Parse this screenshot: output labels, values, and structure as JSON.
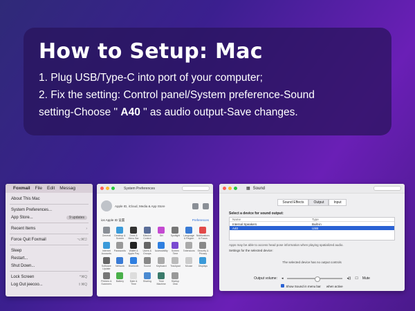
{
  "panel": {
    "title": "How to Setup: Mac",
    "line1": "1. Plug USB/Type-C into port of your computer;",
    "line2": "2. Fix the setting: Control panel/System preference-Sound",
    "line3_pre": "setting-Choose \" ",
    "line3_bold": "A40",
    "line3_post": " \" as audio output-Save changes."
  },
  "apple_menu": {
    "menubar": {
      "apple": "",
      "app": "Foxmail",
      "file": "File",
      "edit": "Edit",
      "message": "Messag"
    },
    "items": [
      {
        "label": "About This Mac"
      },
      {
        "label": "System Preferences..."
      },
      {
        "label": "App Store...",
        "badge": "9 updates"
      },
      {
        "label": "Recent Items",
        "shortcut": "›"
      },
      {
        "label": "Force Quit Foxmail",
        "shortcut": "⌥⌘⎋"
      },
      {
        "label": "Sleep"
      },
      {
        "label": "Restart..."
      },
      {
        "label": "Shut Down..."
      },
      {
        "label": "Lock Screen",
        "shortcut": "^⌘Q"
      },
      {
        "label": "Log Out jeecoo...",
        "shortcut": "⇧⌘Q"
      }
    ]
  },
  "sys_prefs": {
    "title": "System Preferences",
    "user_line": "Apple ID, iCloud, Media & App Store",
    "sub_left": "ios Apple ID 设置",
    "sub_right": "Preferences",
    "icons": [
      {
        "label": "General",
        "color": "#8a8f96"
      },
      {
        "label": "Desktop & Screen Saver",
        "color": "#3a9ad9"
      },
      {
        "label": "Dock & Menu Bar",
        "color": "#333"
      },
      {
        "label": "Mission Control",
        "color": "#5b6e99"
      },
      {
        "label": "Siri",
        "color": "#c44ad1"
      },
      {
        "label": "Spotlight",
        "color": "#777"
      },
      {
        "label": "Language & Region",
        "color": "#3a7bd5"
      },
      {
        "label": "Notifications & Focus",
        "color": "#e24a4a"
      },
      {
        "label": "Internet Accounts",
        "color": "#3a9ad9"
      },
      {
        "label": "Passwords",
        "color": "#999"
      },
      {
        "label": "Wallet & Apple Pay",
        "color": "#222"
      },
      {
        "label": "Users & Groups",
        "color": "#666"
      },
      {
        "label": "Accessibility",
        "color": "#2f7fe0"
      },
      {
        "label": "Screen Time",
        "color": "#7b4ad1"
      },
      {
        "label": "Extensions",
        "color": "#aaa"
      },
      {
        "label": "Security & Privacy",
        "color": "#888"
      },
      {
        "label": "Software Update",
        "color": "#666"
      },
      {
        "label": "Network",
        "color": "#3a7bd5"
      },
      {
        "label": "Bluetooth",
        "color": "#2f7fe0"
      },
      {
        "label": "Sound",
        "color": "#888"
      },
      {
        "label": "Keyboard",
        "color": "#aaa"
      },
      {
        "label": "Trackpad",
        "color": "#bbb"
      },
      {
        "label": "Mouse",
        "color": "#ccc"
      },
      {
        "label": "Displays",
        "color": "#3a9ad9"
      },
      {
        "label": "Printers & Scanners",
        "color": "#777"
      },
      {
        "label": "Battery",
        "color": "#4ab04a"
      },
      {
        "label": "Date & Time",
        "color": "#ddd"
      },
      {
        "label": "Sharing",
        "color": "#4a8ad1"
      },
      {
        "label": "Time Machine",
        "color": "#3a7a6a"
      },
      {
        "label": "Startup Disk",
        "color": "#999"
      }
    ]
  },
  "sound": {
    "title": "Sound",
    "tabs": [
      "Sound Effects",
      "Output",
      "Input"
    ],
    "select_label": "Select a device for sound output:",
    "col_name": "Name",
    "col_type": "Type",
    "devices": [
      {
        "name": "Internal Speakers",
        "type": "Built-in",
        "selected": false
      },
      {
        "name": "A40",
        "type": "USB",
        "selected": true
      }
    ],
    "note": "Apps may be able to access head pose information when playing spatialized audio.",
    "settings_for": "Settings for the selected device:",
    "no_controls": "The selected device has no output controls",
    "output_volume": "Output volume:",
    "mute": "Mute",
    "show_sound": "Show Sound in menu bar",
    "when_active": "when active"
  }
}
